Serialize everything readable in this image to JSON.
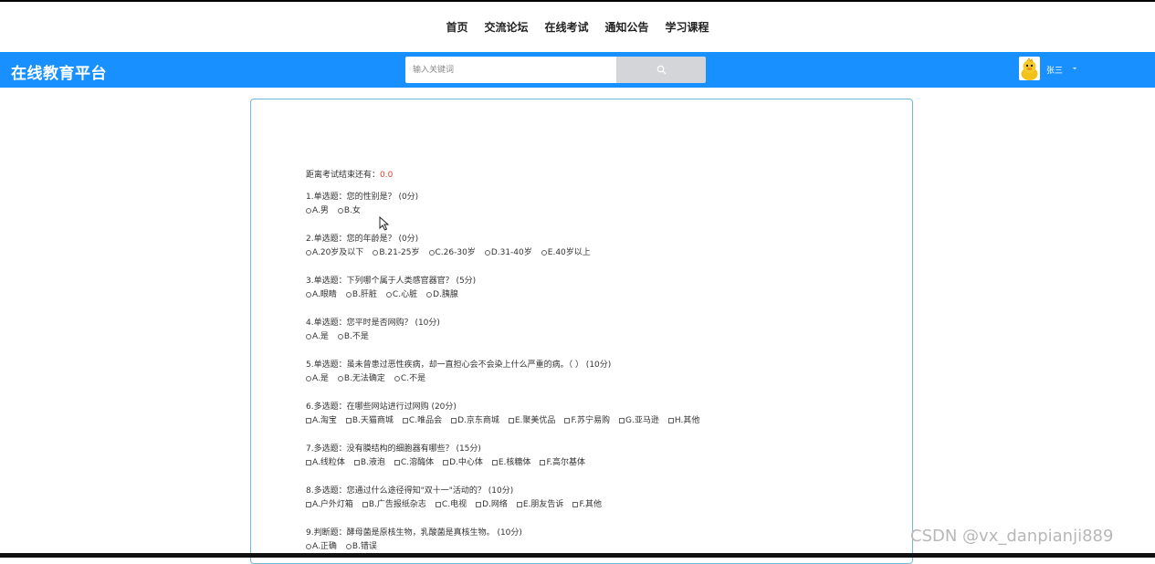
{
  "nav": {
    "items": [
      "首页",
      "交流论坛",
      "在线考试",
      "通知公告",
      "学习课程"
    ]
  },
  "header": {
    "brand": "在线教育平台",
    "search_placeholder": "输入关键词",
    "username": "张三",
    "accent_color": "#1890ff"
  },
  "exam": {
    "countdown_label": "距离考试结束还有：",
    "countdown_value": "0.0",
    "questions": [
      {
        "title": "1.单选题：您的性别是？ (0分)",
        "type": "radio",
        "options": [
          "A.男",
          "B.女"
        ]
      },
      {
        "title": "2.单选题：您的年龄是？ (0分)",
        "type": "radio",
        "options": [
          "A.20岁及以下",
          "B.21-25岁",
          "C.26-30岁",
          "D.31-40岁",
          "E.40岁以上"
        ]
      },
      {
        "title": "3.单选题：下列哪个属于人类感官器官？ (5分)",
        "type": "radio",
        "options": [
          "A.眼睛",
          "B.肝脏",
          "C.心脏",
          "D.胰腺"
        ]
      },
      {
        "title": "4.单选题：您平时是否网购？ (10分)",
        "type": "radio",
        "options": [
          "A.是",
          "B.不是"
        ]
      },
      {
        "title": "5.单选题：虽未曾患过恶性疾病，却一直担心会不会染上什么严重的病。（ ） (10分)",
        "type": "radio",
        "options": [
          "A.是",
          "B.无法确定",
          "C.不是"
        ]
      },
      {
        "title": "6.多选题：在哪些网站进行过网购 (20分)",
        "type": "checkbox",
        "options": [
          "A.淘宝",
          "B.天猫商城",
          "C.唯品会",
          "D.京东商城",
          "E.聚美优品",
          "F.苏宁易购",
          "G.亚马逊",
          "H.其他"
        ]
      },
      {
        "title": "7.多选题：没有膜结构的细胞器有哪些？ (15分)",
        "type": "checkbox",
        "options": [
          "A.线粒体",
          "B.液泡",
          "C.溶酶体",
          "D.中心体",
          "E.核糖体",
          "F.高尔基体"
        ]
      },
      {
        "title": "8.多选题：您通过什么途径得知\"双十一\"活动的？ (10分)",
        "type": "checkbox",
        "options": [
          "A.户外灯箱",
          "B.广告报纸杂志",
          "C.电视",
          "D.网络",
          "E.朋友告诉",
          "F.其他"
        ]
      },
      {
        "title": "9.判断题：酵母菌是原核生物，乳酸菌是真核生物。 (10分)",
        "type": "radio",
        "options": [
          "A.正确",
          "B.错误"
        ]
      }
    ]
  },
  "watermark": "CSDN @vx_danpianji889",
  "icons": {
    "search": "search-icon",
    "avatar": "duck-avatar",
    "caret": "caret-down-icon",
    "cursor": "mouse-cursor-icon"
  }
}
